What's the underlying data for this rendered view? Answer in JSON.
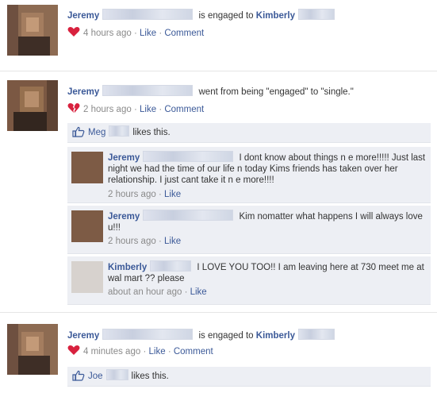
{
  "colors": {
    "link": "#3b5998",
    "meta": "#8a8a8a",
    "comment_bg": "#edeff4",
    "heart": "#d8213e"
  },
  "posts": [
    {
      "name": "Jeremy",
      "action": "is engaged to",
      "target": "Kimberly",
      "heart_icon": "heart-icon",
      "time": "4 hours ago",
      "like": "Like",
      "comment": "Comment"
    },
    {
      "name": "Jeremy",
      "action": "went from being \"engaged\" to \"single.\"",
      "heart_icon": "broken-heart-icon",
      "time": "2 hours ago",
      "like": "Like",
      "comment": "Comment",
      "likes": {
        "name": "Meg",
        "text": "likes this."
      },
      "comments": [
        {
          "name": "Jeremy",
          "text": "I dont know about things n e more!!!!! Just last night we had the time of our life n today Kims friends has taken over her relationship. I just cant take it n e more!!!!",
          "time": "2 hours ago",
          "like": "Like"
        },
        {
          "name": "Jeremy",
          "text": "Kim nomatter what happens I will always love u!!!",
          "time": "2 hours ago",
          "like": "Like"
        },
        {
          "name": "Kimberly",
          "text": "I LOVE YOU TOO!! I am leaving here at 730 meet me at wal mart ?? please",
          "time": "about an hour ago",
          "like": "Like"
        }
      ]
    },
    {
      "name": "Jeremy",
      "action": "is engaged to",
      "target": "Kimberly",
      "heart_icon": "heart-icon",
      "time": "4 minutes ago",
      "like": "Like",
      "comment": "Comment",
      "likes": {
        "name": "Joe",
        "text": "likes this."
      }
    }
  ]
}
